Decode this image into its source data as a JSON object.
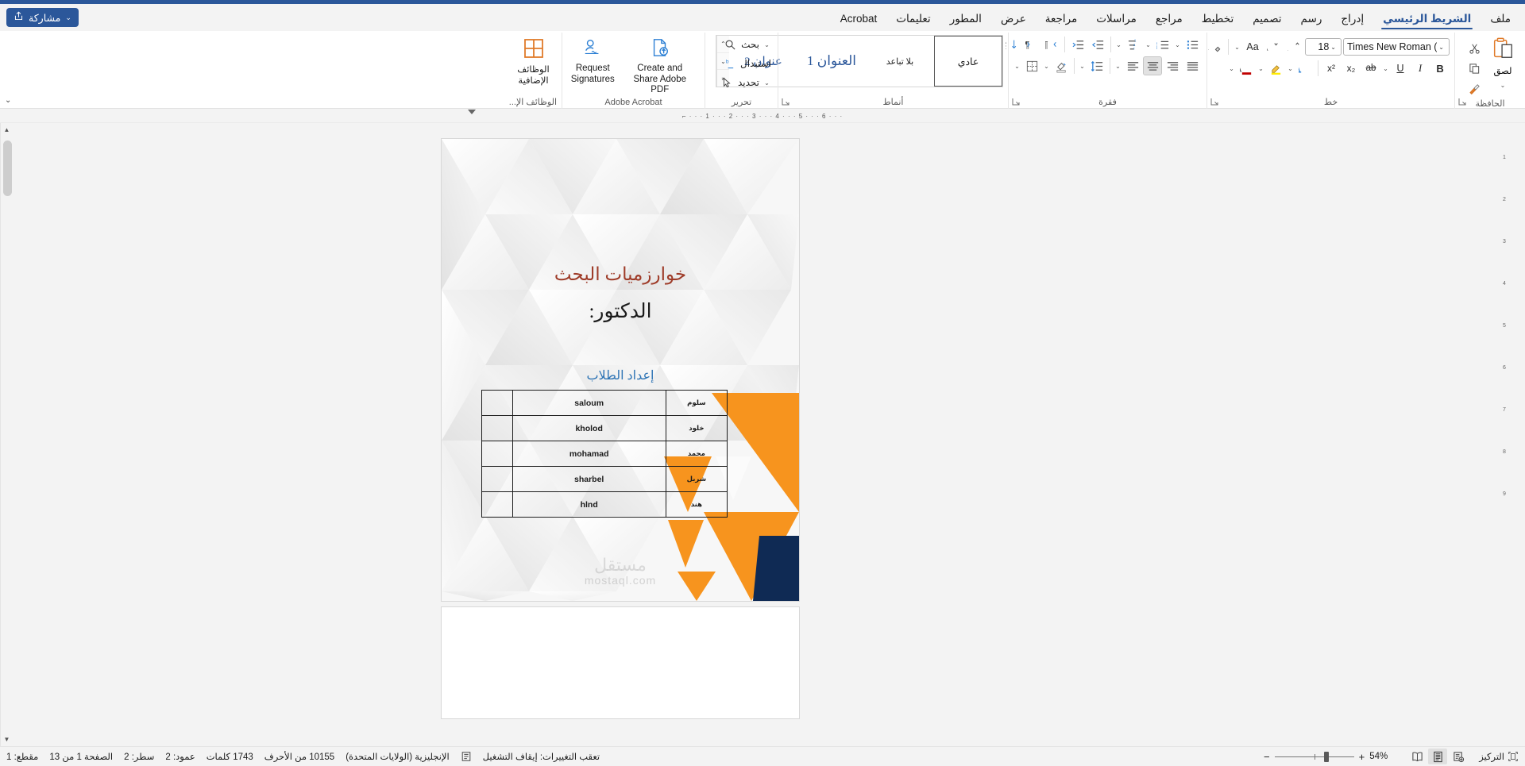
{
  "app": {
    "accent_blue": "#2b579a",
    "title_color": "#9e3b28"
  },
  "titlebar": {
    "share_label": "مشاركة",
    "share_icon": "share-icon",
    "share_caret": "⌄"
  },
  "tabs": [
    {
      "label": "ملف",
      "active": false,
      "name": "tab-file"
    },
    {
      "label": "الشريط الرئيسي",
      "active": true,
      "name": "tab-home"
    },
    {
      "label": "إدراج",
      "active": false,
      "name": "tab-insert"
    },
    {
      "label": "رسم",
      "active": false,
      "name": "tab-draw"
    },
    {
      "label": "تصميم",
      "active": false,
      "name": "tab-design"
    },
    {
      "label": "تخطيط",
      "active": false,
      "name": "tab-layout"
    },
    {
      "label": "مراجع",
      "active": false,
      "name": "tab-references"
    },
    {
      "label": "مراسلات",
      "active": false,
      "name": "tab-mailings"
    },
    {
      "label": "مراجعة",
      "active": false,
      "name": "tab-review"
    },
    {
      "label": "عرض",
      "active": false,
      "name": "tab-view"
    },
    {
      "label": "المطور",
      "active": false,
      "name": "tab-developer"
    },
    {
      "label": "تعليمات",
      "active": false,
      "name": "tab-help"
    },
    {
      "label": "Acrobat",
      "active": false,
      "name": "tab-acrobat",
      "latin": true
    }
  ],
  "ribbon": {
    "clipboard": {
      "group_label": "الحافظة",
      "paste_label": "لصق",
      "paste_caret": "⌄",
      "cut_icon": "scissors-icon",
      "copy_icon": "copy-icon",
      "format_painter_icon": "format-painter-icon"
    },
    "font": {
      "group_label": "خط",
      "font_name": "Times New Roman (",
      "font_size": "18",
      "bold_label": "B",
      "italic_label": "I",
      "underline_label": "U",
      "strikethrough_label": "ab",
      "subscript_label": "x₂",
      "superscript_label": "x²",
      "text_effects_icon": "text-effects-icon",
      "highlight_icon": "highlight-icon",
      "font_color_icon": "font-color-icon",
      "grow_font_icon": "grow-font-icon",
      "shrink_font_icon": "shrink-font-icon",
      "change_case_label": "Aa",
      "clear_formatting_icon": "clear-formatting-icon"
    },
    "paragraph": {
      "group_label": "فقرة",
      "bullets_icon": "bullets-icon",
      "numbering_icon": "numbering-icon",
      "multilevel_icon": "multilevel-list-icon",
      "decrease_indent_icon": "decrease-indent-icon",
      "increase_indent_icon": "increase-indent-icon",
      "rtl_icon": "rtl-paragraph-icon",
      "ltr_icon": "ltr-paragraph-icon",
      "sort_icon": "sort-icon",
      "show_marks_icon": "show-formatting-marks-icon",
      "align_left_icon": "align-left-icon",
      "align_center_icon": "align-center-icon",
      "align_right_icon": "align-right-icon",
      "justify_icon": "justify-icon",
      "line_spacing_icon": "line-spacing-icon",
      "shading_icon": "shading-icon",
      "borders_icon": "borders-icon"
    },
    "styles": {
      "group_label": "أنماط",
      "items": [
        {
          "label": "عادي",
          "kind": "normal",
          "selected": true
        },
        {
          "label": "بلا تباعد",
          "kind": "nospace",
          "selected": false
        },
        {
          "label": "العنوان 1",
          "kind": "h1",
          "selected": false
        },
        {
          "label": "عنوان 2",
          "kind": "h2",
          "selected": false
        }
      ],
      "scroll_up": "⌃",
      "scroll_down": "⌄",
      "scroll_more": "⌅"
    },
    "editing": {
      "group_label": "تحرير",
      "find_label": "بحث",
      "replace_label": "استبدال",
      "select_label": "تحديد",
      "find_icon": "search-icon",
      "replace_icon": "replace-icon",
      "select_icon": "cursor-select-icon",
      "caret": "⌄"
    },
    "acrobat": {
      "group_label": "Adobe Acrobat",
      "create_share_label": "Create and\nShare Adobe PDF",
      "request_sig_label": "Request\nSignatures",
      "create_icon": "pdf-upload-icon",
      "signature_icon": "signature-icon"
    },
    "addins": {
      "group_label": "الوظائف الإ...",
      "button_label": "الوظائف\nالإضافية",
      "icon": "addins-grid-icon"
    },
    "collapse_caret": "⌄"
  },
  "ruler": {
    "marks": "⌐ · · · 1 · · · 2 · · · 3 · · · 4 · · · 5 · · · 6 · · ·",
    "vertical_marks": [
      "1",
      "2",
      "3",
      "4",
      "5",
      "6",
      "7",
      "8",
      "9"
    ]
  },
  "document": {
    "title": "خوارزميات البحث",
    "subtitle": "الدكتور:",
    "prepared_by": "إعداد الطلاب",
    "table": {
      "rows": [
        {
          "blank": "",
          "en": "saloum",
          "ar": "سلوم"
        },
        {
          "blank": "",
          "en": "kholod",
          "ar": "خلود"
        },
        {
          "blank": "",
          "en": "mohamad",
          "ar": "محمد"
        },
        {
          "blank": "",
          "en": "sharbel",
          "ar": "شربل"
        },
        {
          "blank": "",
          "en": "hlnd",
          "ar": "هند"
        }
      ]
    },
    "watermark_main": "مستقل",
    "watermark_sub": "mostaql.com"
  },
  "statusbar": {
    "page_info": "الصفحة 1 من 13",
    "section_info": "مقطع: 1",
    "line_info": "سطر: 2",
    "column_info": "عمود: 2",
    "word_count": "1743 كلمات",
    "char_count": "10155 من الأحرف",
    "language": "الإنجليزية (الولايات المتحدة)",
    "track_changes": "تعقب التغييرات: إيقاف التشغيل",
    "accessibility_icon": "accessibility-icon",
    "proofing_icon": "proofing-icon",
    "focus_label": "التركيز",
    "focus_icon": "focus-icon",
    "view_read_icon": "read-mode-icon",
    "view_print_icon": "print-layout-icon",
    "view_web_icon": "web-layout-icon",
    "zoom_percent": "54%",
    "zoom_out": "−",
    "zoom_in": "+"
  }
}
